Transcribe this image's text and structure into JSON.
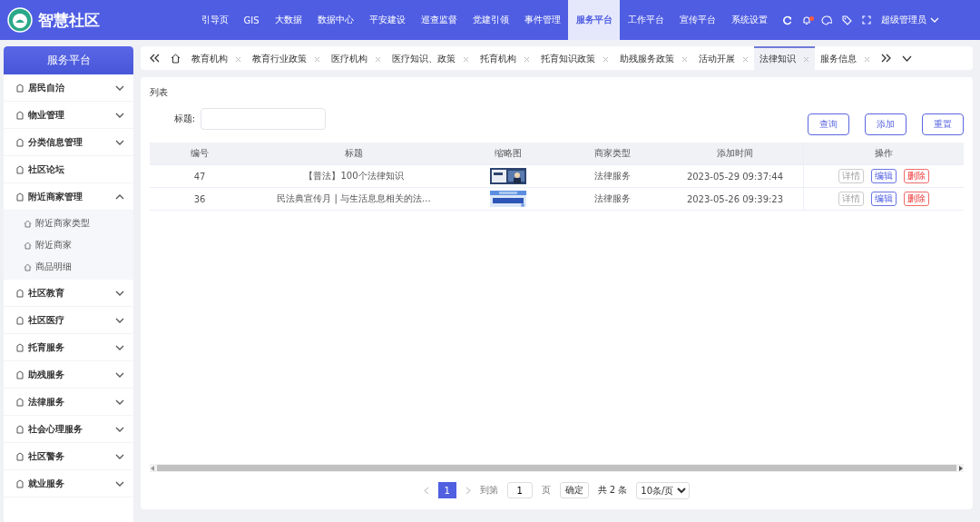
{
  "header": {
    "app_title": "智慧社区",
    "nav": [
      {
        "label": "引导页",
        "selected": false
      },
      {
        "label": "GIS",
        "selected": false
      },
      {
        "label": "大数据",
        "selected": false
      },
      {
        "label": "数据中心",
        "selected": false
      },
      {
        "label": "平安建设",
        "selected": false
      },
      {
        "label": "巡查监督",
        "selected": false
      },
      {
        "label": "党建引领",
        "selected": false
      },
      {
        "label": "事件管理",
        "selected": false
      },
      {
        "label": "服务平台",
        "selected": true
      },
      {
        "label": "工作平台",
        "selected": false
      },
      {
        "label": "宣传平台",
        "selected": false
      },
      {
        "label": "系统设置",
        "selected": false
      }
    ],
    "has_unread": true,
    "user": "超级管理员"
  },
  "tabs": [
    {
      "label": "教育机构",
      "selected": false
    },
    {
      "label": "教育行业政策",
      "selected": false
    },
    {
      "label": "医疗机构",
      "selected": false
    },
    {
      "label": "医疗知识、政策",
      "selected": false
    },
    {
      "label": "托育机构",
      "selected": false
    },
    {
      "label": "托育知识政策",
      "selected": false
    },
    {
      "label": "助残服务政策",
      "selected": false
    },
    {
      "label": "活动开展",
      "selected": false
    },
    {
      "label": "法律知识",
      "selected": true
    },
    {
      "label": "服务信息",
      "selected": false
    }
  ],
  "sidebar": {
    "title": "服务平台",
    "items": [
      {
        "label": "居民自治",
        "kind": "group",
        "expanded": false
      },
      {
        "label": "物业管理",
        "kind": "group",
        "expanded": false
      },
      {
        "label": "分类信息管理",
        "kind": "group",
        "expanded": false
      },
      {
        "label": "社区论坛",
        "kind": "leaf"
      },
      {
        "label": "附近商家管理",
        "kind": "group",
        "expanded": true,
        "children": [
          {
            "label": "附近商家类型"
          },
          {
            "label": "附近商家"
          },
          {
            "label": "商品明细"
          }
        ]
      },
      {
        "label": "社区教育",
        "kind": "group",
        "expanded": false
      },
      {
        "label": "社区医疗",
        "kind": "group",
        "expanded": false
      },
      {
        "label": "托育服务",
        "kind": "group",
        "expanded": false
      },
      {
        "label": "助残服务",
        "kind": "group",
        "expanded": false
      },
      {
        "label": "法律服务",
        "kind": "group",
        "expanded": false
      },
      {
        "label": "社会心理服务",
        "kind": "group",
        "expanded": false
      },
      {
        "label": "社区警务",
        "kind": "group",
        "expanded": false
      },
      {
        "label": "就业服务",
        "kind": "group",
        "expanded": false
      }
    ]
  },
  "panel": {
    "section_label": "列表",
    "filter_label": "标题:",
    "buttons": [
      "查询",
      "添加",
      "重置"
    ],
    "table": {
      "columns": [
        "编号",
        "标题",
        "缩略图",
        "商家类型",
        "添加时间",
        "操作"
      ],
      "rows": [
        {
          "id": "47",
          "title": "【普法】100个法律知识",
          "type": "法律服务",
          "time": "2023-05-29 09:37:44",
          "actions": [
            {
              "label": "详情",
              "kind": "detail"
            },
            {
              "label": "编辑",
              "kind": "edit"
            },
            {
              "label": "删除",
              "kind": "delete"
            }
          ]
        },
        {
          "id": "36",
          "title": "民法典宣传月 | 与生活息息相关的法...",
          "type": "法律服务",
          "time": "2023-05-26 09:39:23",
          "actions": [
            {
              "label": "详情",
              "kind": "detail"
            },
            {
              "label": "编辑",
              "kind": "edit"
            },
            {
              "label": "删除",
              "kind": "delete"
            }
          ]
        }
      ]
    },
    "pagination": {
      "current_page": "1",
      "goto_label": "到第",
      "goto_value": "1",
      "page_unit": "页",
      "confirm": "确定",
      "total": "共 2 条",
      "page_size": "10条/页"
    }
  }
}
